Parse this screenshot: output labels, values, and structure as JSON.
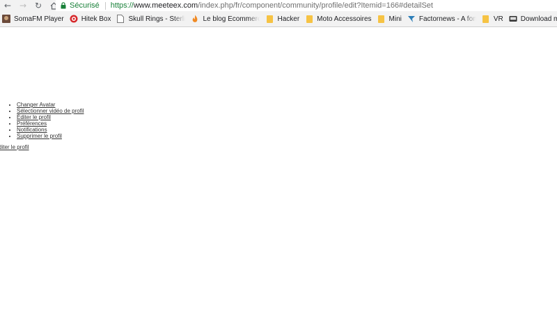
{
  "browser": {
    "security_label": "Sécurisé",
    "url": {
      "scheme": "https://",
      "host": "www.meeteex.com",
      "path": "/index.php/fr/component/community/profile/edit?Itemid=166#detailSet"
    }
  },
  "bookmarks": [
    {
      "label": "SomaFM Player",
      "icon": "somafm-favicon"
    },
    {
      "label": "Hitek Box",
      "icon": "hitek-favicon"
    },
    {
      "label": "Skull Rings - Sterling",
      "icon": "page-icon"
    },
    {
      "label": "Le blog Ecommerce d",
      "icon": "blog-favicon"
    },
    {
      "label": "Hacker",
      "icon": "folder-icon"
    },
    {
      "label": "Moto Accessoires",
      "icon": "folder-icon"
    },
    {
      "label": "Mini",
      "icon": "folder-icon"
    },
    {
      "label": "Factornews - A fond d",
      "icon": "factornews-favicon"
    },
    {
      "label": "VR",
      "icon": "folder-icon"
    },
    {
      "label": "Download music, mo",
      "icon": "download-favicon"
    }
  ],
  "profile_menu": [
    "Changer Avatar",
    "Sélectionner vidéo de profil",
    "Éditer le profil",
    "Préférences",
    "Notifications",
    "Supprimer le profil"
  ],
  "edit_link": "diter le profil"
}
